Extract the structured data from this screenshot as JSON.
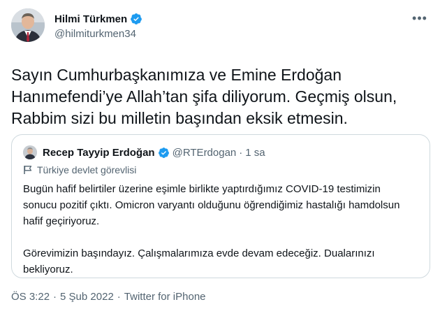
{
  "author": {
    "name": "Hilmi Türkmen",
    "handle": "@hilmiturkmen34",
    "avatar_icon": "person-photo",
    "verified_icon": "verified-badge-icon",
    "more_icon": "more-dots-icon"
  },
  "tweet": {
    "text": "Sayın Cumhurbaşkanımıza ve Emine Erdoğan\nHanımefendi’ye Allah’tan şifa diliyorum. Geçmiş olsun,\nRabbim sizi bu milletin başından eksik etmesin."
  },
  "quote": {
    "name": "Recep Tayyip Erdoğan",
    "handle": "@RTErdogan",
    "dot": "·",
    "time": "1 sa",
    "label": "Türkiye devlet görevlisi",
    "label_icon": "flag-icon",
    "body": "Bugün hafif belirtiler üzerine eşimle birlikte yaptırdığımız COVID-19 testimizin\nsonucu pozitif çıktı. Omicron varyantı olduğunu öğrendiğimiz hastalığı hamdolsun\nhafif geçiriyoruz.\n\nGörevimizin başındayız. Çalışmalarımıza evde devam edeceğiz. Dualarınızı\nbekliyoruz."
  },
  "meta": {
    "time": "ÖS 3:22",
    "sep1": "·",
    "date": "5 Şub 2022",
    "sep2": "·",
    "source": "Twitter for iPhone"
  },
  "colors": {
    "verified_blue": "#1d9bf0",
    "secondary_text": "#536471",
    "border": "#cfd9de"
  }
}
